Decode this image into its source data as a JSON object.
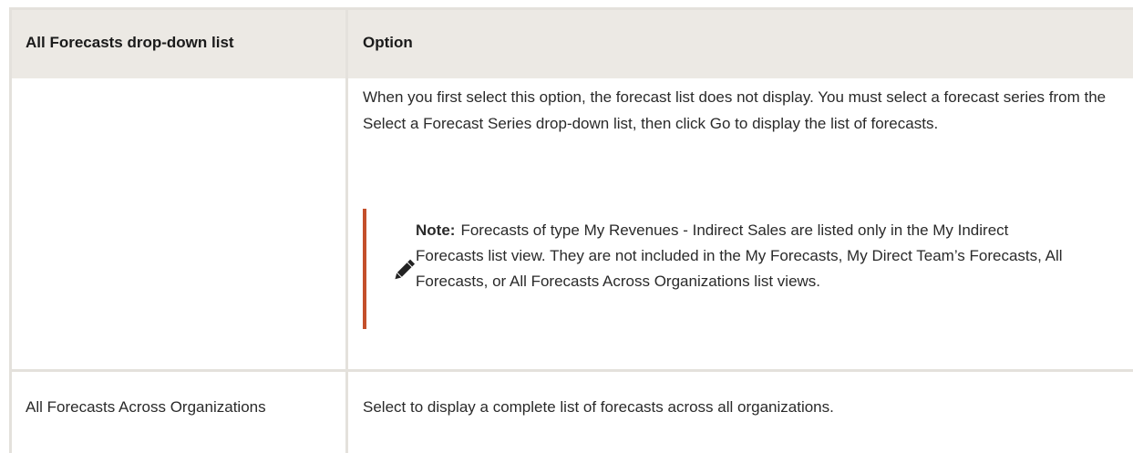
{
  "table": {
    "headers": [
      "All Forecasts drop-down list",
      "Option"
    ],
    "rows": [
      {
        "list_item": "",
        "option_text": "When you first select this option, the forecast list does not display. You must select a forecast series from the Select a Forecast Series drop-down list, then click Go to display the list of forecasts.",
        "note": {
          "label": "Note:",
          "text": "Forecasts of type My Revenues - Indirect Sales are listed only in the My Indirect Forecasts list view. They are not included in the My Forecasts, My Direct Team’s Forecasts, All Forecasts, or All Forecasts Across Organizations list views.",
          "icon": "pencil-icon",
          "accent_color": "#c4502b"
        }
      },
      {
        "list_item": "All Forecasts Across Organizations",
        "option_text": "Select to display a complete list of forecasts across all organizations."
      }
    ]
  },
  "colors": {
    "header_bg": "#ece9e4",
    "grid_line": "#e4e1dc",
    "note_accent": "#c4502b"
  }
}
